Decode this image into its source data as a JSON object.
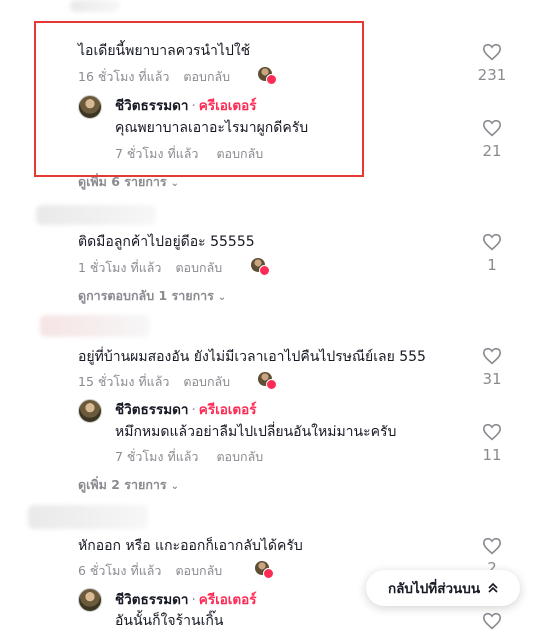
{
  "threads": [
    {
      "comment": "ไอเดียนี้พยาบาลควรนำไปใช้",
      "time": "16 ชั่วโมง ที่แล้ว",
      "reply": "ตอบกลับ",
      "likes": "231",
      "creator_reply": {
        "name": "ชีวิตธรรมดา",
        "dot": "·",
        "badge": "ครีเอเตอร์",
        "text": "คุณพยาบาลเอาอะไรมาผูกดีครับ",
        "time": "7 ชั่วโมง ที่แล้ว",
        "reply": "ตอบกลับ",
        "likes": "21"
      },
      "more": "ดูเพิ่ม 6 รายการ"
    },
    {
      "comment": "ติดมือลูกค้าไปอยู่ดีอะ 55555",
      "time": "1 ชั่วโมง ที่แล้ว",
      "reply": "ตอบกลับ",
      "likes": "1",
      "more": "ดูการตอบกลับ 1 รายการ"
    },
    {
      "comment": "อยู่ที่บ้านผมสองอัน ยังไม่มีเวลาเอาไปคืนไปรษณีย์เลย 555",
      "time": "15 ชั่วโมง ที่แล้ว",
      "reply": "ตอบกลับ",
      "likes": "31",
      "creator_reply": {
        "name": "ชีวิตธรรมดา",
        "dot": "·",
        "badge": "ครีเอเตอร์",
        "text": "หมึกหมดแล้วอย่าลืมไปเปลี่ยนอันใหม่มานะครับ",
        "time": "7 ชั่วโมง ที่แล้ว",
        "reply": "ตอบกลับ",
        "likes": "11"
      },
      "more": "ดูเพิ่ม 2 รายการ"
    },
    {
      "comment": "หักออก หรือ แกะออกก็เอากลับได้ครับ",
      "time": "6 ชั่วโมง ที่แล้ว",
      "reply": "ตอบกลับ",
      "likes": "2",
      "creator_reply": {
        "name": "ชีวิตธรรมดา",
        "dot": "·",
        "badge": "ครีเอเตอร์",
        "text": "อันนั้นก็ใจร้านเกิ๊น"
      }
    }
  ],
  "back_to_top": "กลับไปที่ส่วนบน",
  "icons": {
    "like": "heart-outline-icon",
    "creator_liked": "creator-heart-avatar-icon",
    "expand": "chevron-down-icon",
    "back_top": "double-chevron-up-icon"
  },
  "colors": {
    "creator_badge": "#fe2c55",
    "meta": "#8a8b91",
    "highlight": "#e53935"
  }
}
